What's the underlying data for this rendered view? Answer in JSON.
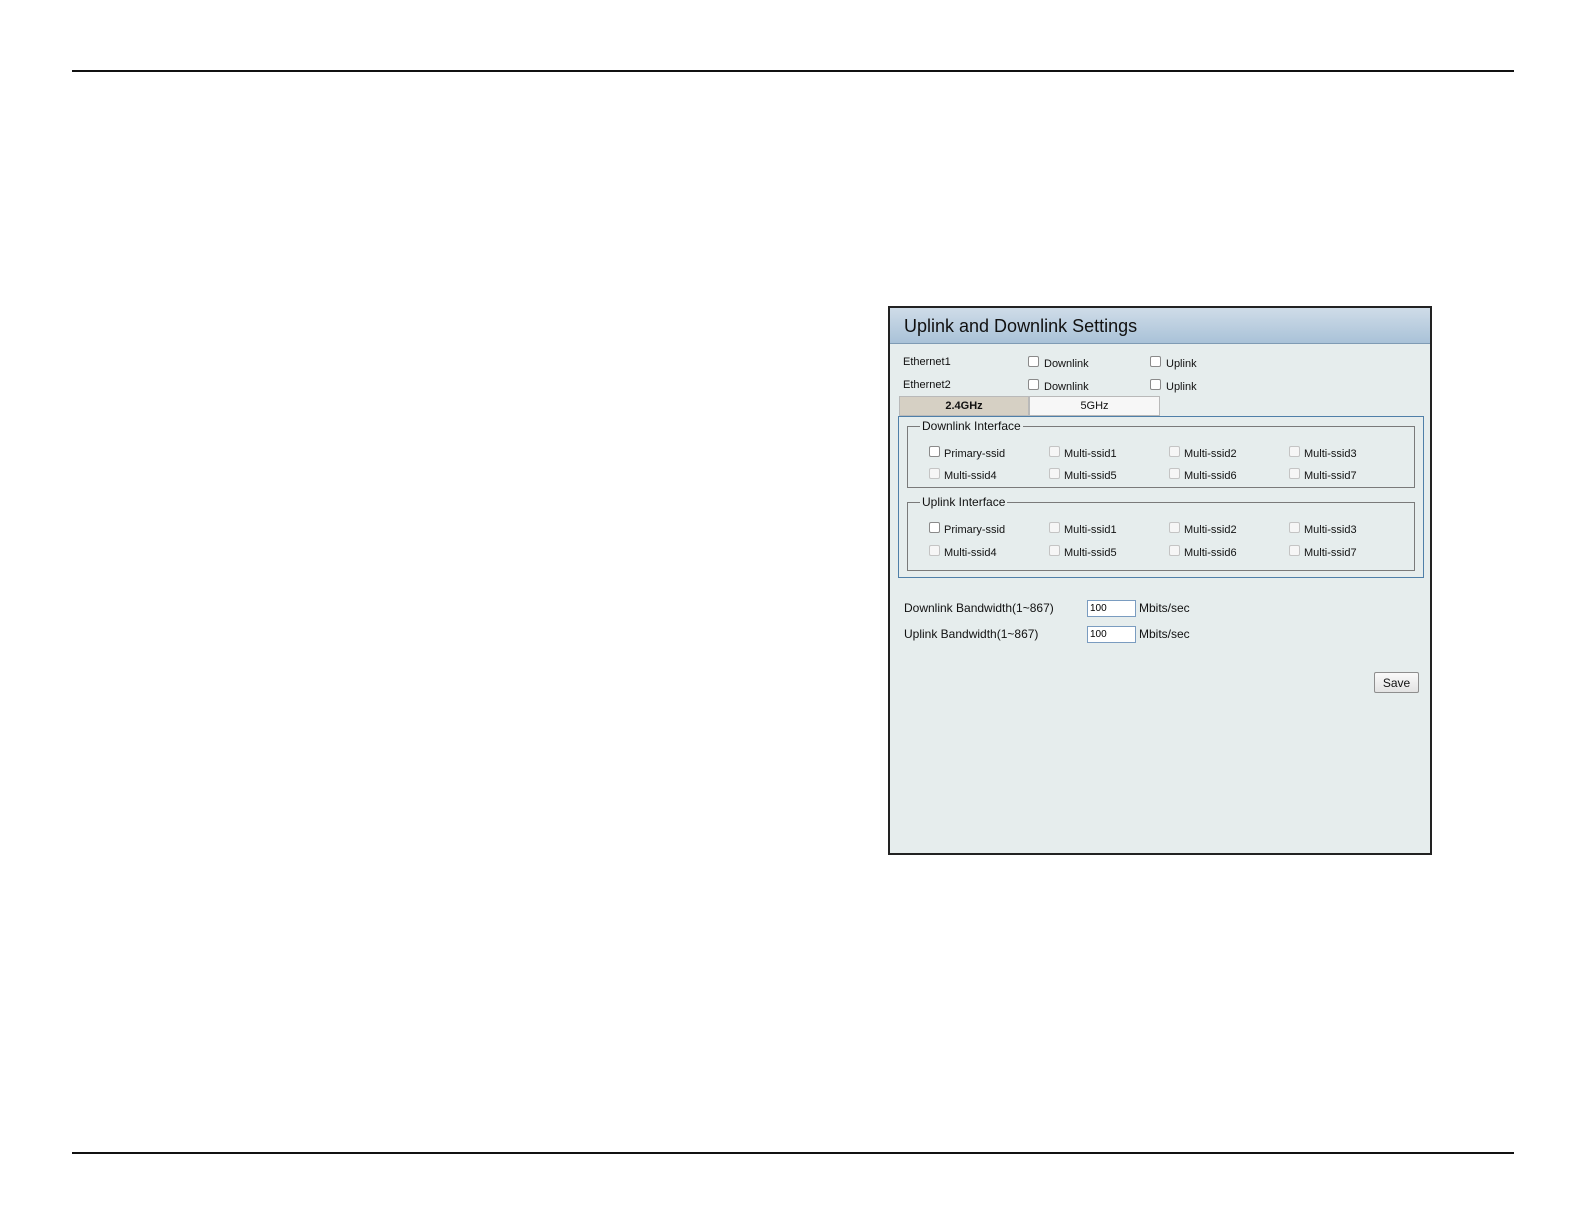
{
  "panel": {
    "title": "Uplink and Downlink Settings"
  },
  "ethernet": [
    {
      "label": "Ethernet1",
      "downlink_label": "Downlink",
      "uplink_label": "Uplink"
    },
    {
      "label": "Ethernet2",
      "downlink_label": "Downlink",
      "uplink_label": "Uplink"
    }
  ],
  "tabs": [
    {
      "label": "2.4GHz",
      "active": true
    },
    {
      "label": "5GHz",
      "active": false
    }
  ],
  "downlink_interface": {
    "legend": "Downlink Interface",
    "items": [
      "Primary-ssid",
      "Multi-ssid1",
      "Multi-ssid2",
      "Multi-ssid3",
      "Multi-ssid4",
      "Multi-ssid5",
      "Multi-ssid6",
      "Multi-ssid7"
    ]
  },
  "uplink_interface": {
    "legend": "Uplink Interface",
    "items": [
      "Primary-ssid",
      "Multi-ssid1",
      "Multi-ssid2",
      "Multi-ssid3",
      "Multi-ssid4",
      "Multi-ssid5",
      "Multi-ssid6",
      "Multi-ssid7"
    ]
  },
  "bandwidth": {
    "downlink_label": "Downlink Bandwidth(1~867)",
    "downlink_value": "100",
    "uplink_label": "Uplink Bandwidth(1~867)",
    "uplink_value": "100",
    "unit": "Mbits/sec"
  },
  "save_label": "Save",
  "colors": {
    "panel_bg": "#e6eded",
    "header_gradient_top": "#cfdce8",
    "header_gradient_bottom": "#a9c2d8",
    "active_tab": "#d6d0c4",
    "tab_body_border": "#4f7fa8"
  }
}
